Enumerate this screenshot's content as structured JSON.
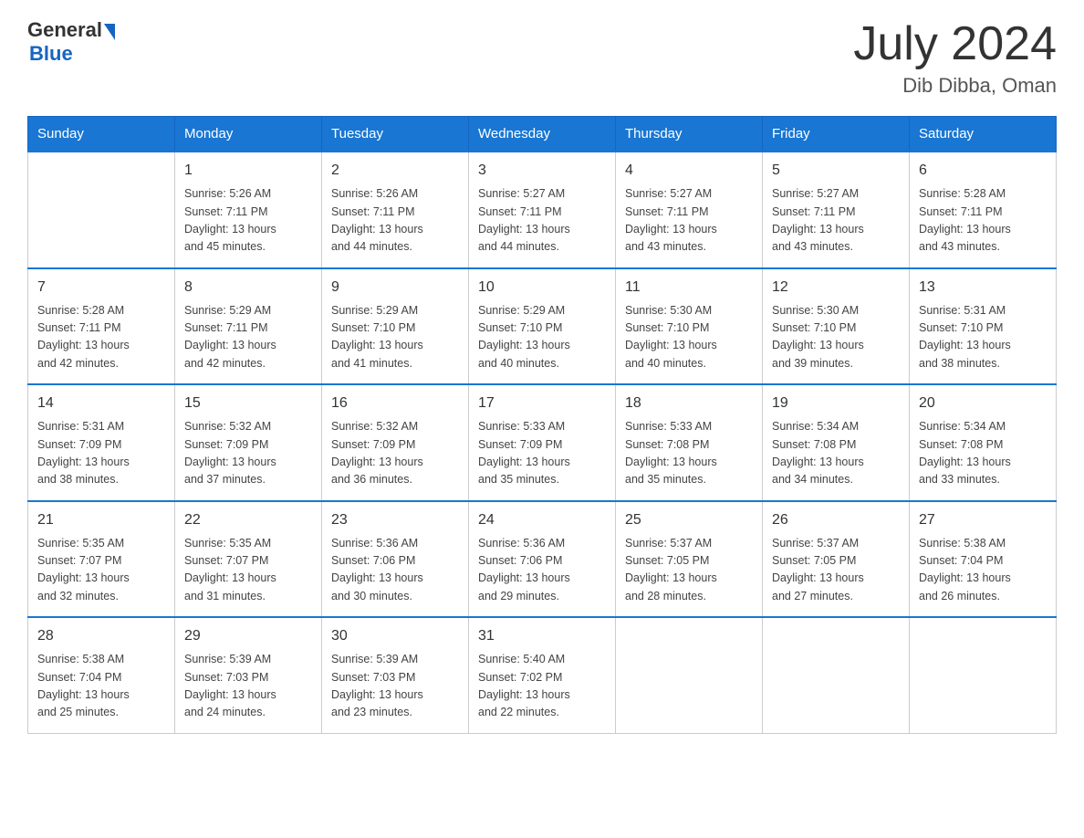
{
  "header": {
    "logo_general": "General",
    "logo_blue": "Blue",
    "title": "July 2024",
    "location": "Dib Dibba, Oman"
  },
  "days_of_week": [
    "Sunday",
    "Monday",
    "Tuesday",
    "Wednesday",
    "Thursday",
    "Friday",
    "Saturday"
  ],
  "weeks": [
    [
      {
        "day": "",
        "info": ""
      },
      {
        "day": "1",
        "info": "Sunrise: 5:26 AM\nSunset: 7:11 PM\nDaylight: 13 hours\nand 45 minutes."
      },
      {
        "day": "2",
        "info": "Sunrise: 5:26 AM\nSunset: 7:11 PM\nDaylight: 13 hours\nand 44 minutes."
      },
      {
        "day": "3",
        "info": "Sunrise: 5:27 AM\nSunset: 7:11 PM\nDaylight: 13 hours\nand 44 minutes."
      },
      {
        "day": "4",
        "info": "Sunrise: 5:27 AM\nSunset: 7:11 PM\nDaylight: 13 hours\nand 43 minutes."
      },
      {
        "day": "5",
        "info": "Sunrise: 5:27 AM\nSunset: 7:11 PM\nDaylight: 13 hours\nand 43 minutes."
      },
      {
        "day": "6",
        "info": "Sunrise: 5:28 AM\nSunset: 7:11 PM\nDaylight: 13 hours\nand 43 minutes."
      }
    ],
    [
      {
        "day": "7",
        "info": "Sunrise: 5:28 AM\nSunset: 7:11 PM\nDaylight: 13 hours\nand 42 minutes."
      },
      {
        "day": "8",
        "info": "Sunrise: 5:29 AM\nSunset: 7:11 PM\nDaylight: 13 hours\nand 42 minutes."
      },
      {
        "day": "9",
        "info": "Sunrise: 5:29 AM\nSunset: 7:10 PM\nDaylight: 13 hours\nand 41 minutes."
      },
      {
        "day": "10",
        "info": "Sunrise: 5:29 AM\nSunset: 7:10 PM\nDaylight: 13 hours\nand 40 minutes."
      },
      {
        "day": "11",
        "info": "Sunrise: 5:30 AM\nSunset: 7:10 PM\nDaylight: 13 hours\nand 40 minutes."
      },
      {
        "day": "12",
        "info": "Sunrise: 5:30 AM\nSunset: 7:10 PM\nDaylight: 13 hours\nand 39 minutes."
      },
      {
        "day": "13",
        "info": "Sunrise: 5:31 AM\nSunset: 7:10 PM\nDaylight: 13 hours\nand 38 minutes."
      }
    ],
    [
      {
        "day": "14",
        "info": "Sunrise: 5:31 AM\nSunset: 7:09 PM\nDaylight: 13 hours\nand 38 minutes."
      },
      {
        "day": "15",
        "info": "Sunrise: 5:32 AM\nSunset: 7:09 PM\nDaylight: 13 hours\nand 37 minutes."
      },
      {
        "day": "16",
        "info": "Sunrise: 5:32 AM\nSunset: 7:09 PM\nDaylight: 13 hours\nand 36 minutes."
      },
      {
        "day": "17",
        "info": "Sunrise: 5:33 AM\nSunset: 7:09 PM\nDaylight: 13 hours\nand 35 minutes."
      },
      {
        "day": "18",
        "info": "Sunrise: 5:33 AM\nSunset: 7:08 PM\nDaylight: 13 hours\nand 35 minutes."
      },
      {
        "day": "19",
        "info": "Sunrise: 5:34 AM\nSunset: 7:08 PM\nDaylight: 13 hours\nand 34 minutes."
      },
      {
        "day": "20",
        "info": "Sunrise: 5:34 AM\nSunset: 7:08 PM\nDaylight: 13 hours\nand 33 minutes."
      }
    ],
    [
      {
        "day": "21",
        "info": "Sunrise: 5:35 AM\nSunset: 7:07 PM\nDaylight: 13 hours\nand 32 minutes."
      },
      {
        "day": "22",
        "info": "Sunrise: 5:35 AM\nSunset: 7:07 PM\nDaylight: 13 hours\nand 31 minutes."
      },
      {
        "day": "23",
        "info": "Sunrise: 5:36 AM\nSunset: 7:06 PM\nDaylight: 13 hours\nand 30 minutes."
      },
      {
        "day": "24",
        "info": "Sunrise: 5:36 AM\nSunset: 7:06 PM\nDaylight: 13 hours\nand 29 minutes."
      },
      {
        "day": "25",
        "info": "Sunrise: 5:37 AM\nSunset: 7:05 PM\nDaylight: 13 hours\nand 28 minutes."
      },
      {
        "day": "26",
        "info": "Sunrise: 5:37 AM\nSunset: 7:05 PM\nDaylight: 13 hours\nand 27 minutes."
      },
      {
        "day": "27",
        "info": "Sunrise: 5:38 AM\nSunset: 7:04 PM\nDaylight: 13 hours\nand 26 minutes."
      }
    ],
    [
      {
        "day": "28",
        "info": "Sunrise: 5:38 AM\nSunset: 7:04 PM\nDaylight: 13 hours\nand 25 minutes."
      },
      {
        "day": "29",
        "info": "Sunrise: 5:39 AM\nSunset: 7:03 PM\nDaylight: 13 hours\nand 24 minutes."
      },
      {
        "day": "30",
        "info": "Sunrise: 5:39 AM\nSunset: 7:03 PM\nDaylight: 13 hours\nand 23 minutes."
      },
      {
        "day": "31",
        "info": "Sunrise: 5:40 AM\nSunset: 7:02 PM\nDaylight: 13 hours\nand 22 minutes."
      },
      {
        "day": "",
        "info": ""
      },
      {
        "day": "",
        "info": ""
      },
      {
        "day": "",
        "info": ""
      }
    ]
  ]
}
